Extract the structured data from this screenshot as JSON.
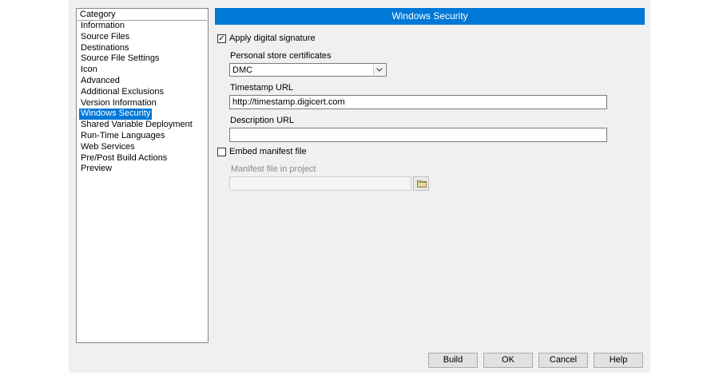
{
  "category": {
    "header": "Category",
    "items": [
      "Information",
      "Source Files",
      "Destinations",
      "Source File Settings",
      "Icon",
      "Advanced",
      "Additional Exclusions",
      "Version Information",
      "Windows Security",
      "Shared Variable Deployment",
      "Run-Time Languages",
      "Web Services",
      "Pre/Post Build Actions",
      "Preview"
    ],
    "selected_index": 8
  },
  "panel": {
    "title": "Windows Security",
    "apply_signature": {
      "label": "Apply digital signature",
      "checked": true,
      "mark": "✓"
    },
    "cert_label": "Personal store certificates",
    "cert_value": "DMC",
    "timestamp_label": "Timestamp URL",
    "timestamp_value": "http://timestamp.digicert.com",
    "description_label": "Description URL",
    "description_value": "",
    "embed_manifest": {
      "label": "Embed manifest file",
      "checked": false
    },
    "manifest_label": "Manifest file in project",
    "manifest_value": ""
  },
  "buttons": {
    "build": "Build",
    "ok": "OK",
    "cancel": "Cancel",
    "help": "Help"
  },
  "colors": {
    "accent": "#0078d7",
    "dialog_bg": "#f0f0f0"
  }
}
